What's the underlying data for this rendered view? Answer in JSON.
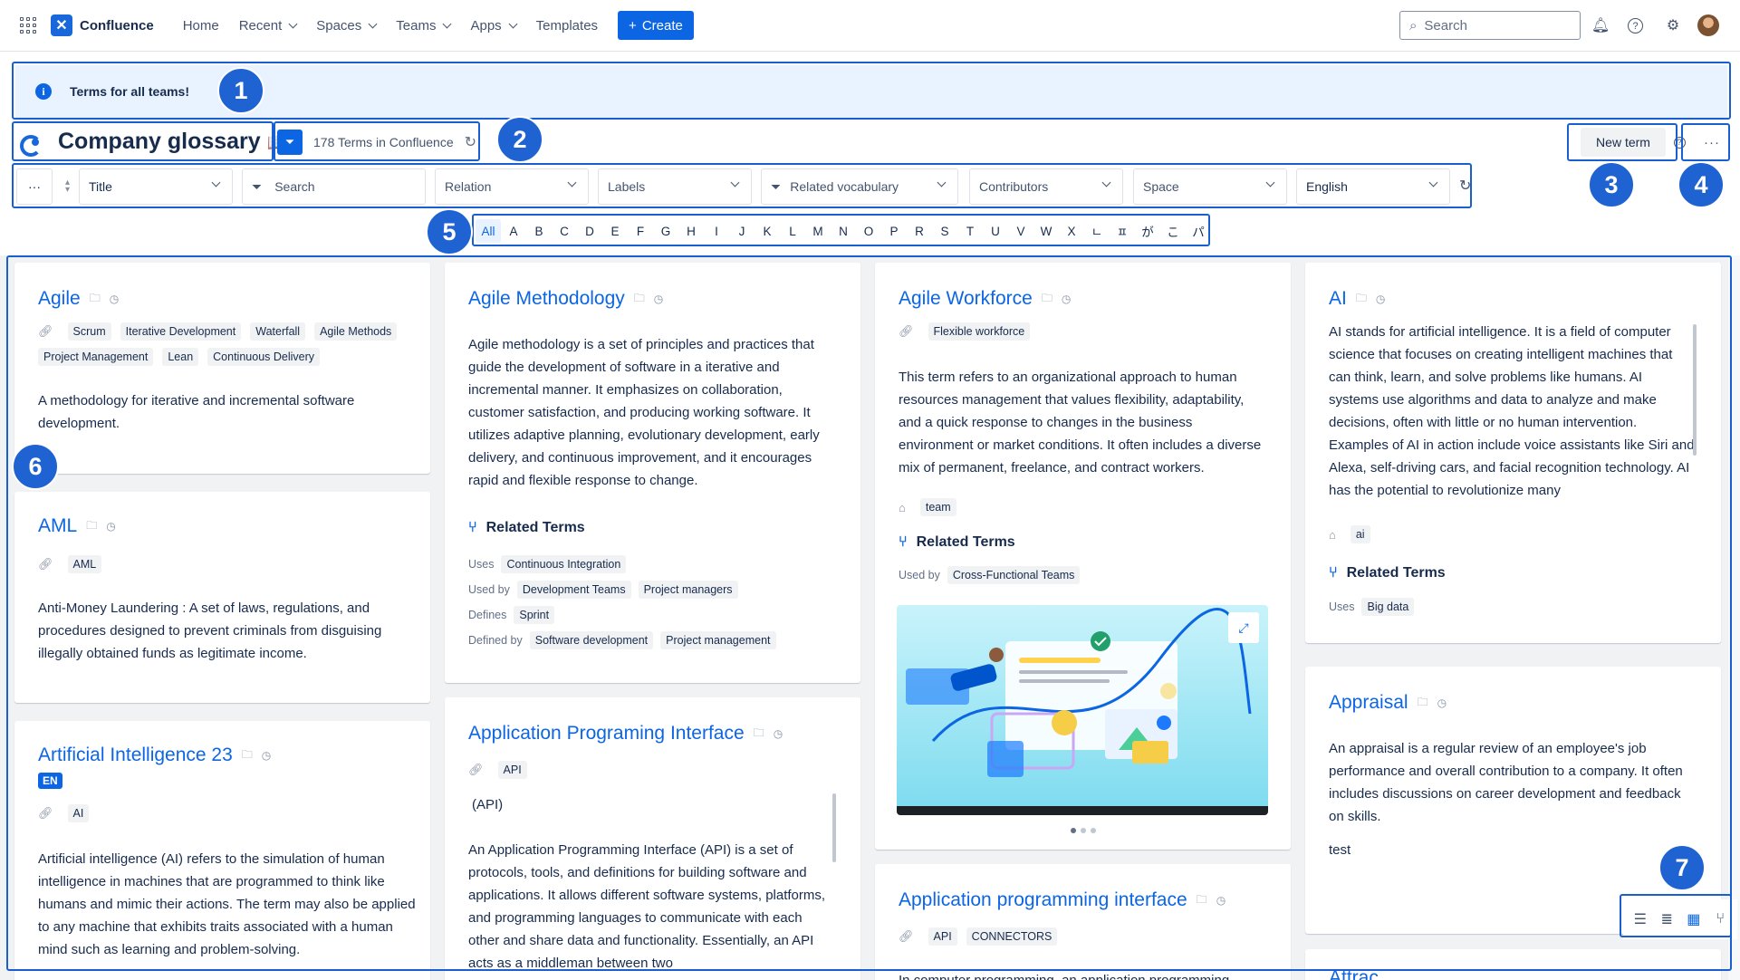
{
  "nav": {
    "app_name": "Confluence",
    "items": [
      "Home",
      "Recent",
      "Spaces",
      "Teams",
      "Apps",
      "Templates"
    ],
    "create_label": "Create",
    "search_placeholder": "Search"
  },
  "banner": {
    "text": "Terms for all teams!"
  },
  "header": {
    "title": "Company glossary",
    "title_emoji": "📖",
    "count_text": "178 Terms in Confluence",
    "new_term_label": "New term",
    "more_label": "···"
  },
  "filters": {
    "more_label": "···",
    "sort": "Title",
    "search_placeholder": "Search",
    "relation": "Relation",
    "labels": "Labels",
    "related_vocabulary": "Related vocabulary",
    "contributors": "Contributors",
    "space": "Space",
    "language": "English"
  },
  "alphabet": [
    "All",
    "A",
    "B",
    "C",
    "D",
    "E",
    "F",
    "G",
    "H",
    "I",
    "J",
    "K",
    "L",
    "M",
    "N",
    "O",
    "P",
    "R",
    "S",
    "T",
    "U",
    "V",
    "W",
    "X",
    "ㄴ",
    "ㅍ",
    "が",
    "こ",
    "パ"
  ],
  "badges": [
    "1",
    "2",
    "3",
    "4",
    "5",
    "6",
    "7"
  ],
  "cards": {
    "agile": {
      "title": "Agile",
      "tags": [
        "Scrum",
        "Iterative Development",
        "Waterfall",
        "Agile Methods",
        "Project Management",
        "Lean",
        "Continuous Delivery"
      ],
      "description": "A methodology for iterative and incremental software development."
    },
    "aml": {
      "title": "AML",
      "tags": [
        "AML"
      ],
      "description": "Anti-Money Laundering : A set of laws, regulations, and procedures designed to prevent criminals from disguising illegally obtained funds as legitimate income."
    },
    "ai23": {
      "title": "Artificial Intelligence 23",
      "lang": "EN",
      "tags": [
        "AI"
      ],
      "description": "Artificial intelligence (AI) refers to the simulation of human intelligence in machines that are programmed to think like humans and mimic their actions. The term may also be applied to any machine that exhibits traits associated with a human mind such as learning and problem-solving."
    },
    "agile_methodology": {
      "title": "Agile Methodology",
      "description": "Agile methodology is a set of principles and practices that guide the development of software in a iterative and incremental manner. It emphasizes on collaboration, customer satisfaction, and producing working software. It utilizes adaptive planning, evolutionary development, early delivery, and continuous improvement, and it encourages rapid and flexible response to change.",
      "related_heading": "Related Terms",
      "relations": [
        {
          "label": "Uses",
          "terms": [
            "Continuous Integration"
          ]
        },
        {
          "label": "Used by",
          "terms": [
            "Development Teams",
            "Project managers"
          ]
        },
        {
          "label": "Defines",
          "terms": [
            "Sprint"
          ]
        },
        {
          "label": "Defined by",
          "terms": [
            "Software development",
            "Project management"
          ]
        }
      ]
    },
    "api": {
      "title": "Application Programing Interface",
      "tags": [
        "API"
      ],
      "abbr": "(API)",
      "description": "An Application Programming Interface (API) is a set of protocols, tools, and definitions for building software and applications. It allows different software systems, platforms, and programming languages to communicate with each other and share data and functionality. Essentially, an API acts as a middleman between two"
    },
    "agile_workforce": {
      "title": "Agile Workforce",
      "tags": [
        "Flexible workforce"
      ],
      "description": "This term refers to an organizational approach to human resources management that values flexibility, adaptability, and a quick response to changes in the business environment or market conditions. It often includes a diverse mix of permanent, freelance, and contract workers.",
      "labels": [
        "team"
      ],
      "related_heading": "Related Terms",
      "relations": [
        {
          "label": "Used by",
          "terms": [
            "Cross-Functional Teams"
          ]
        }
      ]
    },
    "api2": {
      "title": "Application programming interface",
      "tags": [
        "API",
        "CONNECTORS"
      ],
      "description": "In computer programming, an application programming"
    },
    "ai": {
      "title": "AI",
      "description": "AI stands for artificial intelligence. It is a field of computer science that focuses on creating intelligent machines that can think, learn, and solve problems like humans. AI systems use algorithms and data to analyze and make decisions, often with little or no human intervention. Examples of AI in action include voice assistants like Siri and Alexa, self-driving cars, and facial recognition technology. AI has the potential to revolutionize many",
      "labels": [
        "ai"
      ],
      "related_heading": "Related Terms",
      "relations": [
        {
          "label": "Uses",
          "terms": [
            "Big data"
          ]
        }
      ]
    },
    "appraisal": {
      "title": "Appraisal",
      "description": "An appraisal is a regular review of an employee's job performance and overall contribution to a company. It often includes discussions on career development and feedback on skills.",
      "extra": "test"
    },
    "partial_next": {
      "title": "Attrac..."
    }
  },
  "colors": {
    "accent": "#0c66e4",
    "highlight": "#1f63d2",
    "banner_bg": "#e9f2ff",
    "content_bg": "#f1f2f4"
  }
}
